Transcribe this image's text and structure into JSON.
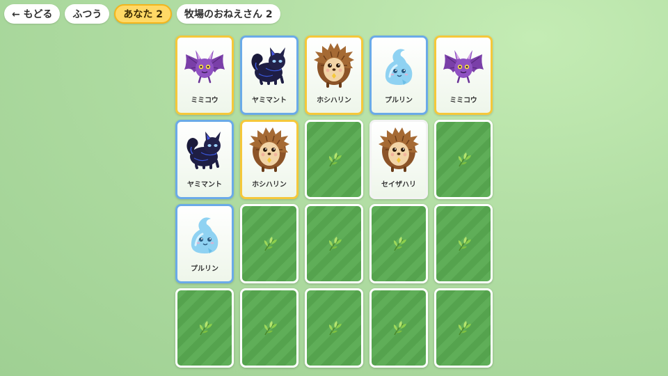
{
  "topbar": {
    "back_label": "← もどる",
    "difficulty": "ふつう",
    "player_score": "あなた 2",
    "opponent_score": "牧場のおねえさん 2"
  },
  "colors": {
    "player_border": "#f5c83a",
    "opponent_border": "#6aaae8",
    "card_back": "#5fae58"
  },
  "board": {
    "rows": 4,
    "cols": 5,
    "cards": [
      {
        "state": "faceup",
        "owner": "you",
        "creature": "bat-icon",
        "name": "ミミコウ"
      },
      {
        "state": "faceup",
        "owner": "opp",
        "creature": "shadow-cat-icon",
        "name": "ヤミマント"
      },
      {
        "state": "faceup",
        "owner": "you",
        "creature": "hedgehog-icon",
        "name": "ホシハリン"
      },
      {
        "state": "faceup",
        "owner": "opp",
        "creature": "water-slime-icon",
        "name": "プルリン"
      },
      {
        "state": "faceup",
        "owner": "you",
        "creature": "bat-icon",
        "name": "ミミコウ"
      },
      {
        "state": "faceup",
        "owner": "opp",
        "creature": "shadow-cat-icon",
        "name": "ヤミマント"
      },
      {
        "state": "faceup",
        "owner": "you",
        "creature": "hedgehog-icon",
        "name": "ホシハリン"
      },
      {
        "state": "facedown"
      },
      {
        "state": "faceup",
        "owner": "none",
        "creature": "hedgehog-icon",
        "name": "セイザハリ"
      },
      {
        "state": "facedown"
      },
      {
        "state": "faceup",
        "owner": "opp",
        "creature": "water-slime-icon",
        "name": "プルリン"
      },
      {
        "state": "facedown"
      },
      {
        "state": "facedown"
      },
      {
        "state": "facedown"
      },
      {
        "state": "facedown"
      },
      {
        "state": "facedown"
      },
      {
        "state": "facedown"
      },
      {
        "state": "facedown"
      },
      {
        "state": "facedown"
      },
      {
        "state": "facedown"
      }
    ]
  }
}
